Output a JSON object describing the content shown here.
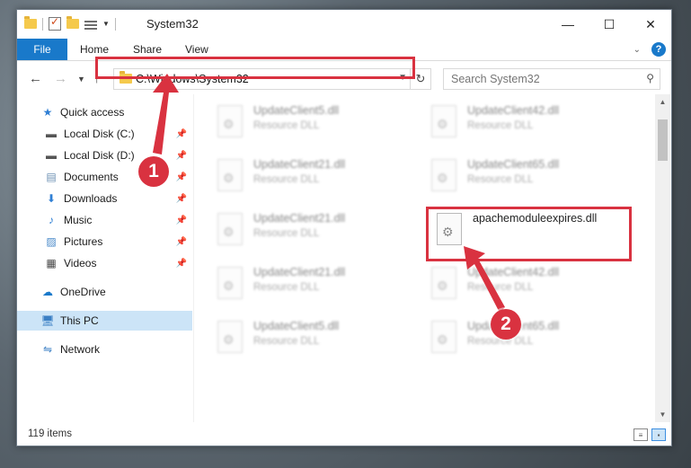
{
  "window": {
    "title": "System32",
    "controls": {
      "minimize": "—",
      "maximize": "☐",
      "close": "✕"
    }
  },
  "ribbon": {
    "tabs": [
      {
        "label": "File"
      },
      {
        "label": "Home"
      },
      {
        "label": "Share"
      },
      {
        "label": "View"
      }
    ]
  },
  "address": {
    "path": "C:\\Windows\\System32",
    "search_placeholder": "Search System32"
  },
  "nav_pane": {
    "items": [
      {
        "label": "Quick access",
        "icon": "star-icon"
      },
      {
        "label": "Local Disk (C:)",
        "icon": "drive-icon",
        "pinned": true
      },
      {
        "label": "Local Disk (D:)",
        "icon": "drive-icon",
        "pinned": true
      },
      {
        "label": "Documents",
        "icon": "documents-icon",
        "pinned": true
      },
      {
        "label": "Downloads",
        "icon": "downloads-icon",
        "pinned": true
      },
      {
        "label": "Music",
        "icon": "music-icon",
        "pinned": true
      },
      {
        "label": "Pictures",
        "icon": "pictures-icon",
        "pinned": true
      },
      {
        "label": "Videos",
        "icon": "videos-icon",
        "pinned": true
      },
      {
        "label": "OneDrive",
        "icon": "cloud-icon"
      },
      {
        "label": "This PC",
        "icon": "computer-icon",
        "selected": true
      },
      {
        "label": "Network",
        "icon": "network-icon"
      }
    ]
  },
  "files": [
    {
      "name": "UpdateClient5.dll",
      "type": "Resource DLL"
    },
    {
      "name": "UpdateClient42.dll",
      "type": "Resource DLL"
    },
    {
      "name": "UpdateClient21.dll",
      "type": "Resource DLL"
    },
    {
      "name": "UpdateClient65.dll",
      "type": "Resource DLL"
    },
    {
      "name": "UpdateClient21.dll",
      "type": "Resource DLL"
    },
    {
      "name": "apachemoduleexpires.dll",
      "type": ""
    },
    {
      "name": "UpdateClient21.dll",
      "type": "Resource DLL"
    },
    {
      "name": "UpdateClient42.dll",
      "type": "Resource DLL"
    },
    {
      "name": "UpdateClient5.dll",
      "type": "Resource DLL"
    },
    {
      "name": "UpdateClient65.dll",
      "type": "Resource DLL"
    }
  ],
  "status": {
    "item_count": "119 items"
  },
  "annotations": {
    "step1": "1",
    "step2": "2",
    "color": "#d93240"
  },
  "colors": {
    "accent": "#1979ca",
    "selection": "#cce4f7",
    "highlight": "#d93240"
  }
}
